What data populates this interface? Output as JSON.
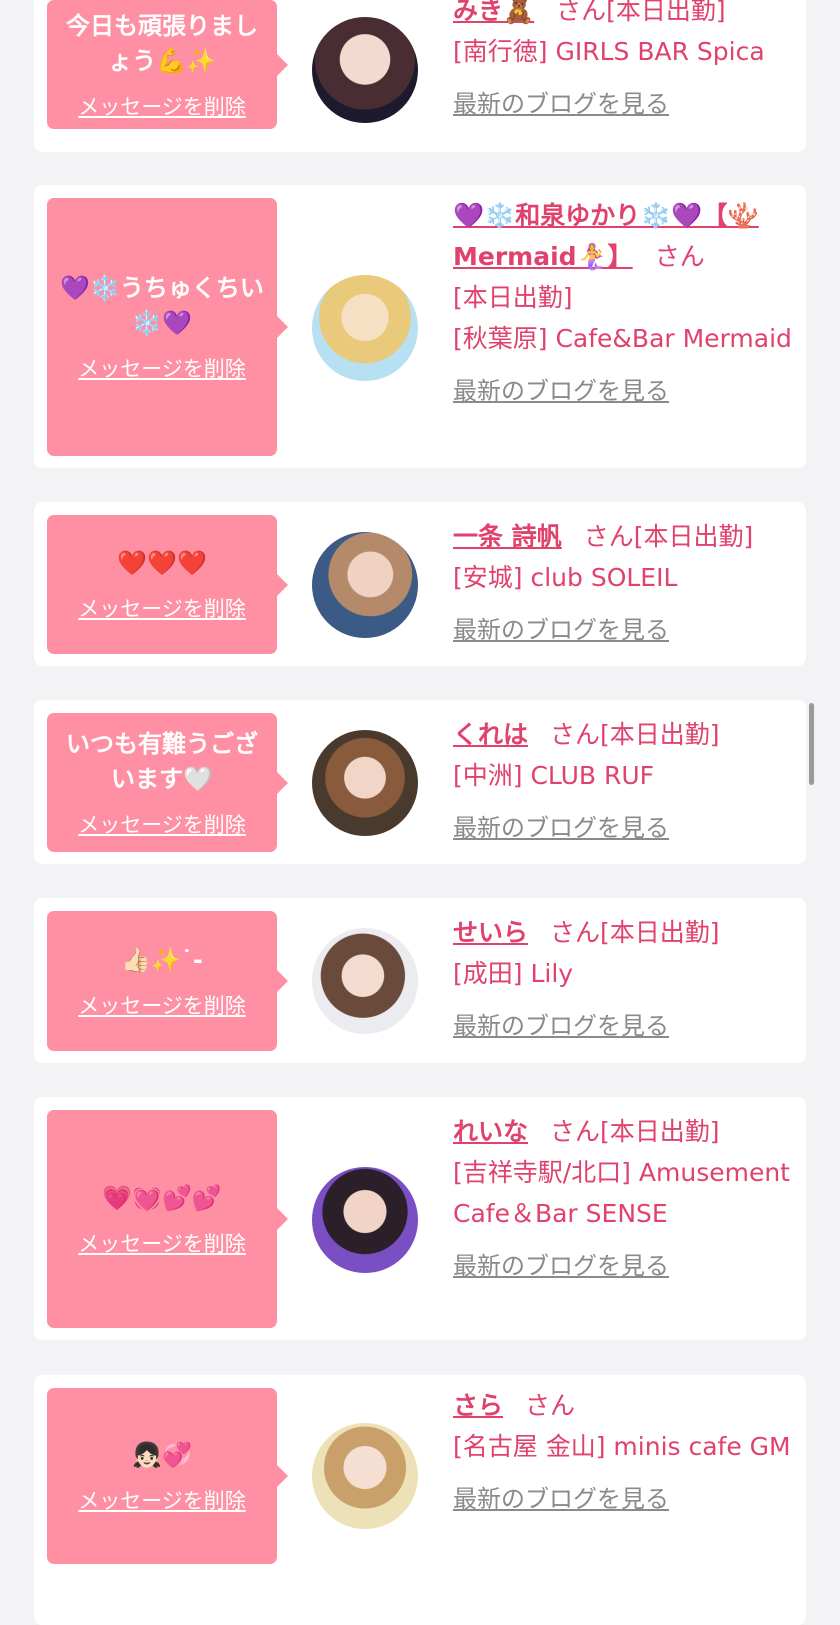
{
  "colors": {
    "accent": "#e0426d",
    "bubble": "#ff8fa3",
    "link_gray": "#8a8a8a",
    "bg": "#f3f3f5"
  },
  "delete_label": "メッセージを削除",
  "blog_label": "最新のブログを見る",
  "san_label": "さん",
  "entries": [
    {
      "message": "今日も頑張りましょう💪✨",
      "name": "みき🧸",
      "status": "[本日出勤]",
      "area": "[南行徳]",
      "shop": "GIRLS BAR Spica"
    },
    {
      "message": "💜❄️うちゅくちい❄️💜",
      "name": "💜❄️和泉ゆかり❄️💜【🪸Mermaid🧜‍♀️】",
      "status": "[本日出勤]",
      "area": "[秋葉原]",
      "shop": "Cafe&Bar Mermaid"
    },
    {
      "message": "❤️❤️❤️",
      "name": "一条 詩帆",
      "status": "[本日出勤]",
      "area": "[安城]",
      "shop": "club SOLEIL"
    },
    {
      "message": "いつも有難うございます🤍",
      "name": "くれは",
      "status": "[本日出勤]",
      "area": "[中洲]",
      "shop": "CLUB RUF"
    },
    {
      "message": "👍🏻✨˙-",
      "name": "せいら",
      "status": "[本日出勤]",
      "area": "[成田]",
      "shop": "Lily"
    },
    {
      "message": "💗💓💕💕",
      "name": "れいな",
      "status": "[本日出勤]",
      "area": "[吉祥寺駅/北口]",
      "shop": "Amusement Cafe＆Bar SENSE"
    },
    {
      "message": "👧🏻💞",
      "name": "さら",
      "status": "",
      "area": "[名古屋 金山]",
      "shop": "minis cafe GM"
    }
  ]
}
